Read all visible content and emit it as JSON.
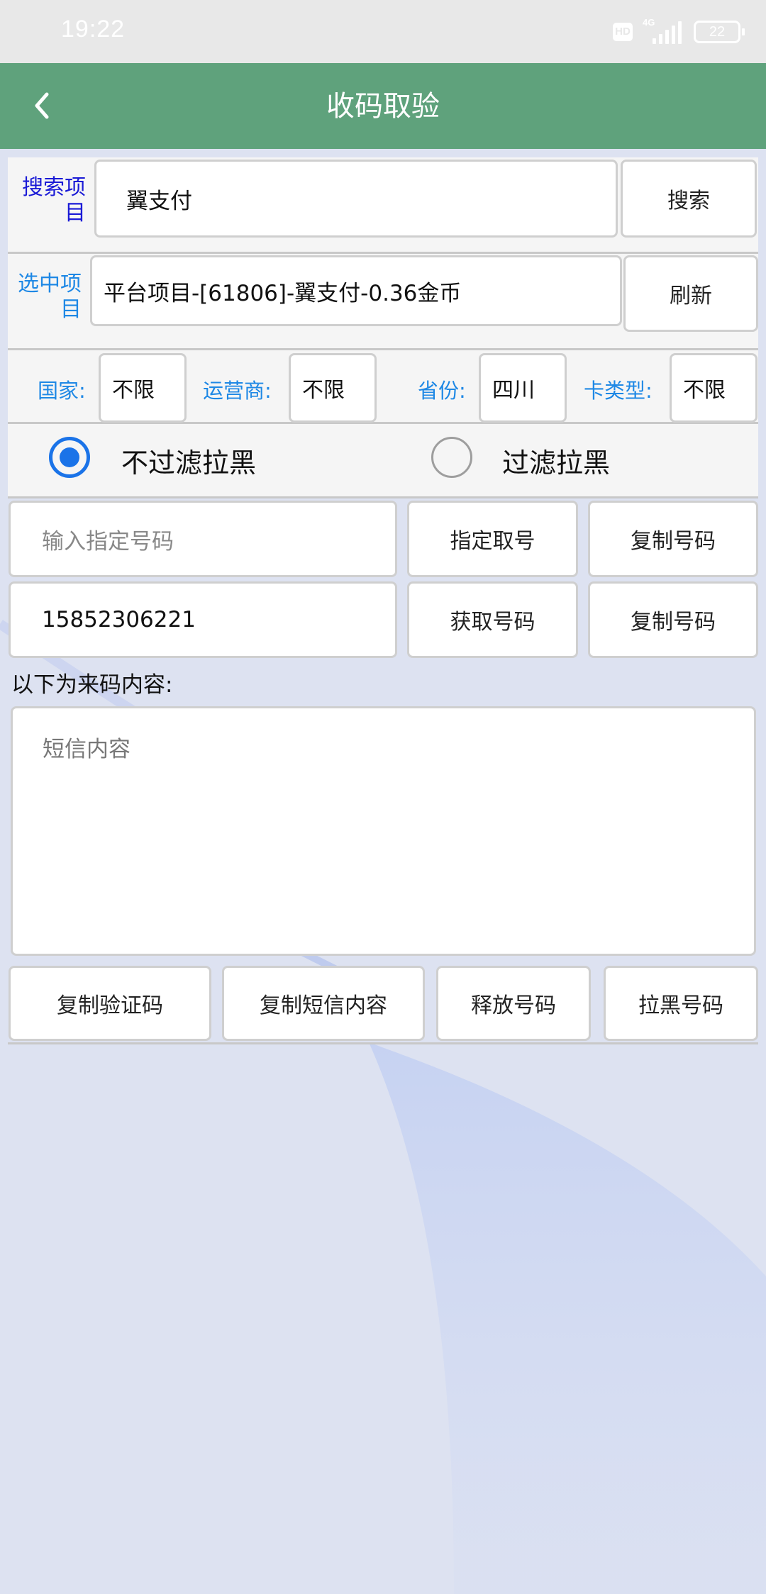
{
  "status_bar": {
    "time": "19:22",
    "hd_label": "HD",
    "network_label": "4G",
    "battery_level": "22"
  },
  "app_bar": {
    "title": "收码取验",
    "back_icon": "chevron-left-icon"
  },
  "search_row": {
    "label": "搜索项目",
    "input_value": "翼支付",
    "button": "搜索"
  },
  "selected_row": {
    "label": "选中项目",
    "value": "平台项目-[61806]-翼支付-0.36金币",
    "button": "刷新"
  },
  "filters": [
    {
      "label": "国家:",
      "value": "不限"
    },
    {
      "label": "运营商:",
      "value": "不限"
    },
    {
      "label": "省份:",
      "value": "四川"
    },
    {
      "label": "卡类型:",
      "value": "不限"
    }
  ],
  "blacklist_filter": {
    "options": [
      {
        "label": "不过滤拉黑",
        "checked": true
      },
      {
        "label": "过滤拉黑",
        "checked": false
      }
    ]
  },
  "number_rows": [
    {
      "input_value": "",
      "input_placeholder": "输入指定号码",
      "action_button": "指定取号",
      "copy_button": "复制号码"
    },
    {
      "input_value": "15852306221",
      "input_placeholder": "",
      "action_button": "获取号码",
      "copy_button": "复制号码"
    }
  ],
  "sms": {
    "section_label": "以下为来码内容:",
    "placeholder": "短信内容",
    "content": ""
  },
  "bottom_buttons": [
    "复制验证码",
    "复制短信内容",
    "释放号码",
    "拉黑号码"
  ],
  "colors": {
    "app_bar": "#5fa27c",
    "search_label": "#1a1ad6",
    "accent_blue": "#1e88e5",
    "radio_checked": "#1a73e8",
    "background": "#dde2f1"
  }
}
